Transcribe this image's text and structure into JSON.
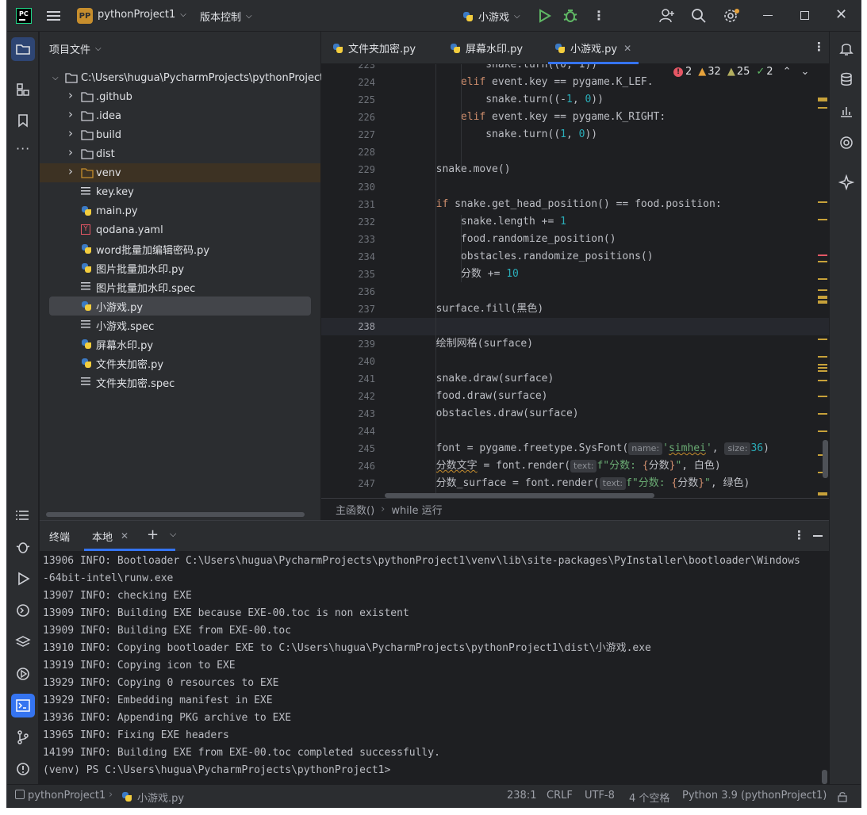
{
  "titlebar": {
    "logo": "PC",
    "project_badge": "PP",
    "project_name": "pythonProject1",
    "vcs_label": "版本控制",
    "run_config": "小游戏"
  },
  "icons": {
    "project": "folder-icon",
    "run": "play-icon",
    "debug": "bug-icon",
    "search": "search-icon",
    "settings": "gear-icon"
  },
  "colors": {
    "accent": "#3574f0",
    "keyword": "#cf8e6d",
    "number": "#2aacb8",
    "string": "#6aab73",
    "warning": "#c78e2d",
    "error": "#e55765"
  },
  "project_panel": {
    "title": "项目文件",
    "root": "C:\\Users\\hugua\\PycharmProjects\\pythonProject",
    "items": [
      {
        "label": ".github",
        "type": "folder"
      },
      {
        "label": ".idea",
        "type": "folder"
      },
      {
        "label": "build",
        "type": "folder"
      },
      {
        "label": "dist",
        "type": "folder"
      },
      {
        "label": "venv",
        "type": "folder-excluded"
      },
      {
        "label": "key.key",
        "type": "text"
      },
      {
        "label": "main.py",
        "type": "python"
      },
      {
        "label": "qodana.yaml",
        "type": "yaml"
      },
      {
        "label": "word批量加编辑密码.py",
        "type": "python"
      },
      {
        "label": "图片批量加水印.py",
        "type": "python"
      },
      {
        "label": "图片批量加水印.spec",
        "type": "text"
      },
      {
        "label": "小游戏.py",
        "type": "python",
        "selected": true
      },
      {
        "label": "小游戏.spec",
        "type": "text"
      },
      {
        "label": "屏幕水印.py",
        "type": "python"
      },
      {
        "label": "文件夹加密.py",
        "type": "python"
      },
      {
        "label": "文件夹加密.spec",
        "type": "text"
      }
    ]
  },
  "editor": {
    "tabs": [
      "文件夹加密.py",
      "屏幕水印.py",
      "小游戏.py"
    ],
    "active_tab": "小游戏.py",
    "inspections": {
      "errors": "2",
      "warnings": "32",
      "weak": "25",
      "typos": "2"
    },
    "breadcrumbs": [
      "主函数()",
      "while 运行"
    ]
  },
  "terminal": {
    "title": "终端",
    "tab": "本地",
    "lines": [
      "13906 INFO: Bootloader C:\\Users\\hugua\\PycharmProjects\\pythonProject1\\venv\\lib\\site-packages\\PyInstaller\\bootloader\\Windows",
      "-64bit-intel\\runw.exe",
      "13907 INFO: checking EXE",
      "13909 INFO: Building EXE because EXE-00.toc is non existent",
      "13909 INFO: Building EXE from EXE-00.toc",
      "13910 INFO: Copying bootloader EXE to C:\\Users\\hugua\\PycharmProjects\\pythonProject1\\dist\\小游戏.exe",
      "13919 INFO: Copying icon to EXE",
      "13929 INFO: Copying 0 resources to EXE",
      "13929 INFO: Embedding manifest in EXE",
      "13936 INFO: Appending PKG archive to EXE",
      "13965 INFO: Fixing EXE headers",
      "14199 INFO: Building EXE from EXE-00.toc completed successfully.",
      "(venv) PS C:\\Users\\hugua\\PycharmProjects\\pythonProject1>"
    ]
  },
  "statusbar": {
    "project": "pythonProject1",
    "file": "小游戏.py",
    "position": "238:1",
    "line_ending": "CRLF",
    "encoding": "UTF-8",
    "indent": "4 个空格",
    "interpreter": "Python 3.9 (pythonProject1)"
  }
}
